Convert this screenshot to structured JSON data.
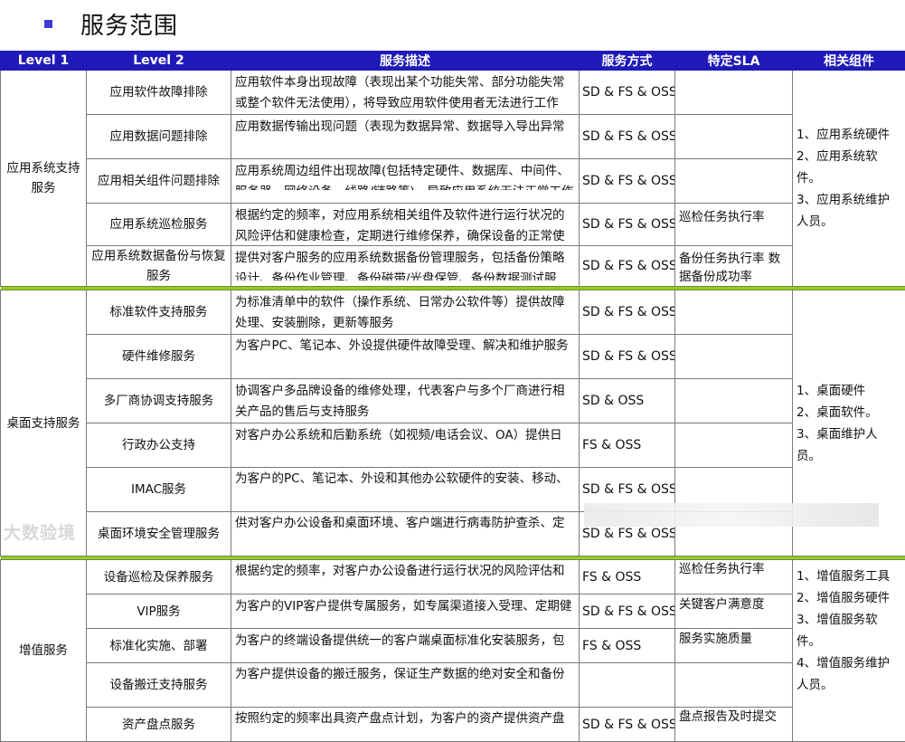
{
  "title": "服务范围",
  "headers": [
    "Level 1",
    "Level 2",
    "服务描述",
    "服务方式",
    "特定SLA",
    "相关组件"
  ],
  "sections": [
    {
      "level1": "应用系统支持服务",
      "components": [
        "1、应用系统硬件",
        "2、应用系统软件。",
        "3、应用系统维护人员。"
      ],
      "rows": [
        {
          "level2": "应用软件故障排除",
          "desc": "应用软件本身出现故障（表现出某个功能失常、部分功能失常或整个软件无法使用），将导致应用软件使用者无法进行工作",
          "mode": "SD & FS & OSS",
          "sla": ""
        },
        {
          "level2": "应用数据问题排除",
          "desc": "应用数据传输出现问题（表现为数据异常、数据导入导出异常",
          "mode": "SD & FS & OSS",
          "sla": ""
        },
        {
          "level2": "应用相关组件问题排除",
          "desc": "应用系统周边组件出现故障(包括特定硬件、数据库、中间件、服务器、网络设备、线路/链路等)，导致应用系统无法正常工作",
          "mode": "SD & FS & OSS",
          "sla": ""
        },
        {
          "level2": "应用系统巡检服务",
          "desc": "根据约定的频率，对应用系统相关组件及软件进行运行状况的风险评估和健康检查，定期进行维修保养，确保设备的正常使",
          "mode": "SD & FS & OSS",
          "sla": "巡检任务执行率"
        },
        {
          "level2": "应用系统数据备份与恢复服务",
          "desc": "提供对客户服务的应用系统数据备份管理服务，包括备份策略设计、备份作业管理、备份磁带/光盘保管、备份数据测试服",
          "mode": "SD & FS & OSS",
          "sla": "备份任务执行率 数据备份成功率"
        }
      ]
    },
    {
      "level1": "桌面支持服务",
      "components": [
        "1、桌面硬件",
        "2、桌面软件。",
        "3、桌面维护人员。"
      ],
      "rows": [
        {
          "level2": "标准软件支持服务",
          "desc": "为标准清单中的软件（操作系统、日常办公软件等）提供故障处理、安装删除，更新等服务",
          "mode": "SD & FS & OSS",
          "sla": ""
        },
        {
          "level2": "硬件维修服务",
          "desc": "为客户PC、笔记本、外设提供硬件故障受理、解决和维护服务",
          "mode": "SD & FS & OSS",
          "sla": ""
        },
        {
          "level2": "多厂商协调支持服务",
          "desc": "协调客户多品牌设备的维修处理，代表客户与多个厂商进行相关产品的售后与支持服务",
          "mode": "SD  & OSS",
          "sla": ""
        },
        {
          "level2": "行政办公支持",
          "desc": "对客户办公系统和后勤系统（如视频/电话会议、OA）提供日",
          "mode": "FS & OSS",
          "sla": ""
        },
        {
          "level2": "IMAC服务",
          "desc": "为客户的PC、笔记本、外设和其他办公软硬件的安装、移动、",
          "mode": "SD & FS & OSS",
          "sla": ""
        },
        {
          "level2": "桌面环境安全管理服务",
          "desc": "供对客户办公设备和桌面环境、客户端进行病毒防护查杀、定",
          "mode": "SD & FS & OSS",
          "sla": ""
        }
      ]
    },
    {
      "level1": "增值服务",
      "components": [
        "1、增值服务工具",
        "2、增值服务硬件",
        "3、增值服务软件。",
        "4、增值服务维护人员。"
      ],
      "rows": [
        {
          "level2": "设备巡检及保养服务",
          "desc": "根据约定的频率，对客户办公设备进行运行状况的风险评估和",
          "mode": "FS & OSS",
          "sla": "巡检任务执行率"
        },
        {
          "level2": "VIP服务",
          "desc": "为客户的VIP客户提供专属服务，如专属渠道接入受理、定期健",
          "mode": "SD & FS & OSS",
          "sla": "关键客户满意度"
        },
        {
          "level2": "标准化实施、部署",
          "desc": "为客户的终端设备提供统一的客户端桌面标准化安装服务，包",
          "mode": "FS & OSS",
          "sla": "服务实施质量"
        },
        {
          "level2": "设备搬迁支持服务",
          "desc": "为客户提供设备的搬迁服务，保证生产数据的绝对安全和备份",
          "mode": "",
          "sla": ""
        },
        {
          "level2": "资产盘点服务",
          "desc": "按照约定的频率出具资产盘点计划，为客户的资产提供资产盘",
          "mode": "SD & FS & OSS",
          "sla": "盘点报告及时提交"
        }
      ]
    }
  ],
  "watermark": "大数验境"
}
